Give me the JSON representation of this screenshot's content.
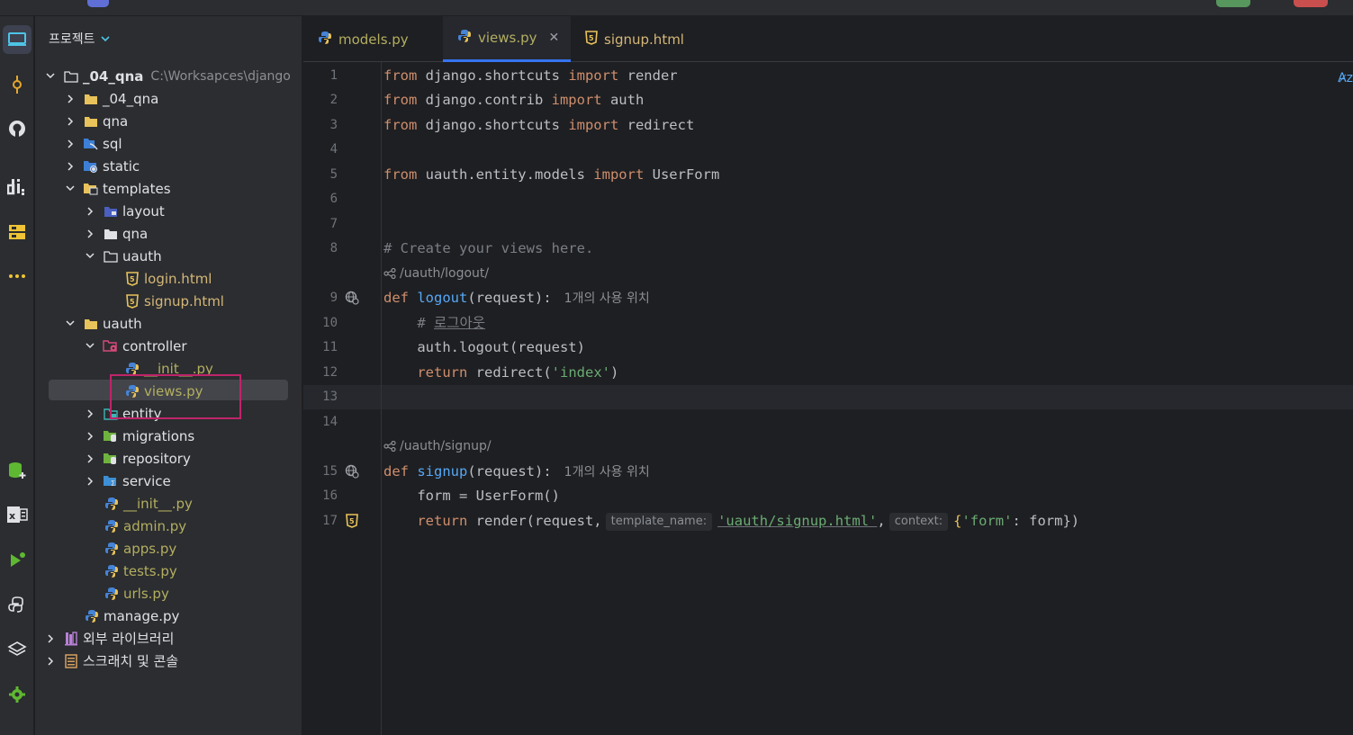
{
  "colors": {
    "accent": "#3574f0",
    "highlight_box": "#c0246a",
    "html_file": "#d5b778",
    "py_file": "#b3ae60"
  },
  "project": {
    "header": "프로젝트",
    "root": {
      "name": "_04_qna",
      "path": "C:\\Worksapces\\django"
    },
    "items": {
      "qna_pkg": "_04_qna",
      "qna": "qna",
      "sql": "sql",
      "static": "static",
      "templates": "templates",
      "layout": "layout",
      "tpl_qna": "qna",
      "tpl_uauth": "uauth",
      "login": "login.html",
      "signup": "signup.html",
      "uauth": "uauth",
      "controller": "controller",
      "ctrl_init": "__init__.py",
      "views": "views.py",
      "entity": "entity",
      "migrations": "migrations",
      "repository": "repository",
      "service": "service",
      "init": "__init__.py",
      "admin": "admin.py",
      "apps": "apps.py",
      "tests": "tests.py",
      "urls": "urls.py",
      "manage": "manage.py",
      "ext_libs": "외부 라이브러리",
      "scratches": "스크래치 및 콘솔"
    }
  },
  "tabs": [
    {
      "label": "models.py"
    },
    {
      "label": "views.py"
    },
    {
      "label": "signup.html"
    }
  ],
  "editor": {
    "line_numbers": [
      "1",
      "2",
      "3",
      "4",
      "5",
      "6",
      "7",
      "8",
      "9",
      "10",
      "11",
      "12",
      "13",
      "14",
      "15",
      "16",
      "17"
    ],
    "lines": {
      "l1": {
        "kw1": "from",
        "mod": " django.shortcuts ",
        "kw2": "import",
        "name": " render"
      },
      "l2": {
        "kw1": "from",
        "mod": " django.contrib ",
        "kw2": "import",
        "name": " auth"
      },
      "l3": {
        "kw1": "from",
        "mod": " django.shortcuts ",
        "kw2": "import",
        "name": " redirect"
      },
      "l5": {
        "kw1": "from",
        "mod": " uauth.entity.models ",
        "kw2": "import",
        "name": " UserForm"
      },
      "l8": "# Create your views here.",
      "route1": "/uauth/logout/",
      "l9": {
        "kw": "def",
        "fn": "logout",
        "rest": "(request):",
        "hint": "1개의 사용 위치"
      },
      "l10": {
        "hash": "# ",
        "text": "로그아웃"
      },
      "l11": "auth.logout(request)",
      "l12": {
        "kw": "return",
        "call": " redirect(",
        "str": "'index'",
        "end": ")"
      },
      "route2": "/uauth/signup/",
      "l15": {
        "kw": "def",
        "fn": "signup",
        "rest": "(request):",
        "hint": "1개의 사용 위치"
      },
      "l16": "form = UserForm()",
      "l17": {
        "kw": "return",
        "call": " render(request,",
        "inlay1": "template_name:",
        "str1": "'uauth/signup.html'",
        "comma": ",",
        "inlay2": "context:",
        "open": "{",
        "str2": "'form'",
        "close": ": form})"
      }
    },
    "corner": "A̷z"
  }
}
